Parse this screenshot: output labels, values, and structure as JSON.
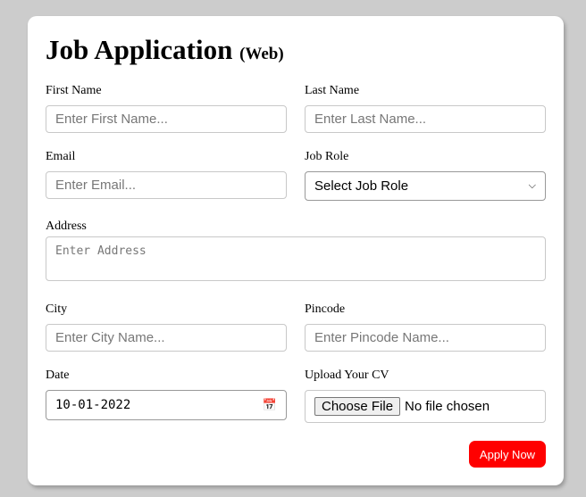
{
  "form": {
    "title": "Job Application",
    "subtitle": "(Web)",
    "first_name": {
      "label": "First Name",
      "placeholder": "Enter First Name..."
    },
    "last_name": {
      "label": "Last Name",
      "placeholder": "Enter Last Name..."
    },
    "email": {
      "label": "Email",
      "placeholder": "Enter Email..."
    },
    "job_role": {
      "label": "Job Role",
      "value": "Select Job Role"
    },
    "address": {
      "label": "Address",
      "placeholder": "Enter Address"
    },
    "city": {
      "label": "City",
      "placeholder": "Enter City Name..."
    },
    "pincode": {
      "label": "Pincode",
      "placeholder": "Enter Pincode Name..."
    },
    "date": {
      "label": "Date",
      "value": "10-01-2022"
    },
    "cv": {
      "label": "Upload Your CV",
      "button": "Choose File",
      "status": "No file chosen"
    },
    "submit": "Apply Now"
  }
}
